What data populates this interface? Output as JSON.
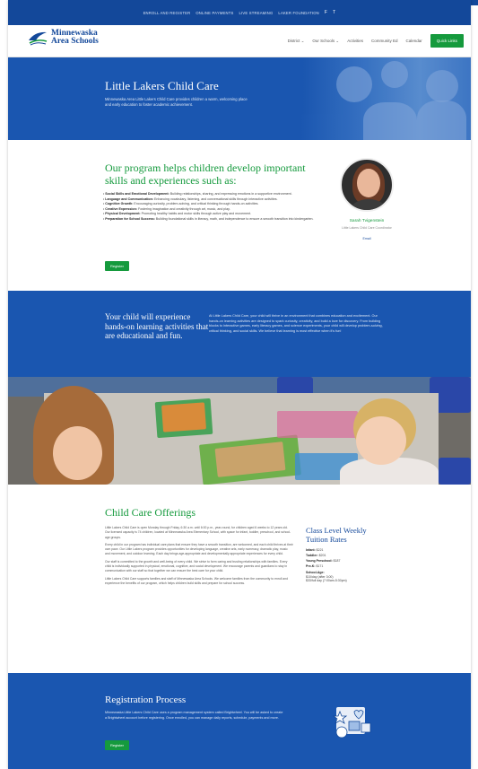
{
  "topbar": {
    "links": [
      "ENROLL AND REGISTER",
      "ONLINE PAYMENTS",
      "LIVE STREAMING",
      "LAKER FOUNDATION"
    ],
    "social": [
      "f",
      "t"
    ]
  },
  "header": {
    "logo_line1": "Minnewaska",
    "logo_line2": "Area Schools",
    "nav": [
      "District ⌄",
      "Our Schools ⌄",
      "Activities",
      "Community Ed",
      "Calendar"
    ],
    "quick_links": "Quick Links"
  },
  "hero": {
    "title": "Little Lakers Child Care",
    "subtitle": "Minnewaska Area Little Lakers Child Care provides children a warm, welcoming place and early education to foster academic achievement."
  },
  "program": {
    "heading": "Our program helps children develop important skills and experiences such as:",
    "items": [
      {
        "label": "Social Skills and Emotional Development:",
        "text": " Building relationships, sharing, and expressing emotions in a supportive environment."
      },
      {
        "label": "Language and Communication:",
        "text": " Enhancing vocabulary, listening, and conversational skills through interactive activities."
      },
      {
        "label": "Cognitive Growth:",
        "text": " Encouraging curiosity, problem-solving, and critical thinking through hands-on activities."
      },
      {
        "label": "Creative Expression:",
        "text": " Fostering imagination and creativity through art, music, and play."
      },
      {
        "label": "Physical Development:",
        "text": " Promoting healthy habits and motor skills through active play and movement."
      },
      {
        "label": "Preparation for School Success:",
        "text": " Building foundational skills in literacy, math, and independence to ensure a smooth transition into kindergarten."
      }
    ],
    "register": "Register",
    "staff_name": "Sarah Tvigenstein",
    "staff_title": "Little Lakers Child Care Coordinator",
    "staff_email": "Email"
  },
  "hands_on": {
    "heading": "Your child will experience hands-on learning activities that are educational and fun.",
    "text": "At Little Lakers Child Care, your child will thrive in an environment that combines education and excitement. Our hands-on learning activities are designed to spark curiosity, creativity, and build a love for discovery. From building blocks to interactive games, early literacy games, and science experiments, your child will develop problem-solving, critical thinking, and social skills. We believe that learning is most effective when it's fun!"
  },
  "offerings": {
    "heading": "Child Care Offerings",
    "paragraphs": [
      "Little Lakers Child Care is open Monday through Friday, 6:30 a.m. until 6:00 p.m., year-round, for children aged 6 weeks to 12 years old. Our licensed capacity is 74 children, located at Minnewaska Area Elementary School, with space for infant, toddler, preschool, and school-age groups.",
      "Every child in our program has individual care plans that ensure they have a smooth transition, are welcomed, and each child thrives at their own pace. Our Little Lakers program provides opportunities for developing language, creative arts, early numeracy, dramatic play, music and movement, and outdoor learning. Each day brings age-appropriate and developmentally appropriate experiences for every child.",
      "Our staff is committed to the growth and well-being of every child. We strive to form caring and trusting relationships with families. Every child is individually supported in physical, emotional, cognitive, and social development. We encourage parents and guardians to stay in communication with our staff so that together we can ensure the best care for your child.",
      "Little Lakers Child Care supports families and staff of Minnewaska Area Schools. We welcome families from the community to enroll and experience the benefits of our program, which helps children build skills and prepare for school success."
    ],
    "rates_heading": "Class Level Weekly Tuition Rates",
    "rates": [
      {
        "label": "Infant:",
        "value": " $221"
      },
      {
        "label": "Toddler:",
        "value": " $201"
      },
      {
        "label": "Young Preschool:",
        "value": " $187"
      },
      {
        "label": "Pre-K:",
        "value": " $171"
      }
    ],
    "ages_label": "School-Age:",
    "ages_lines": [
      "$10/day (after 3:00)",
      "$33/full day (7:00am-5:30pm)"
    ]
  },
  "registration": {
    "heading": "Registration Process",
    "text": "Minnewaska Little Lakers Child Care uses a program management system called Brightwheel. You will be asked to create a Brightwheel account before registering. Once enrolled, you can manage daily reports, schedule, payments and more.",
    "register": "Register"
  },
  "colors": {
    "brand_blue": "#1a56b0",
    "top_blue": "#13489a",
    "accent_green": "#159a3d"
  }
}
